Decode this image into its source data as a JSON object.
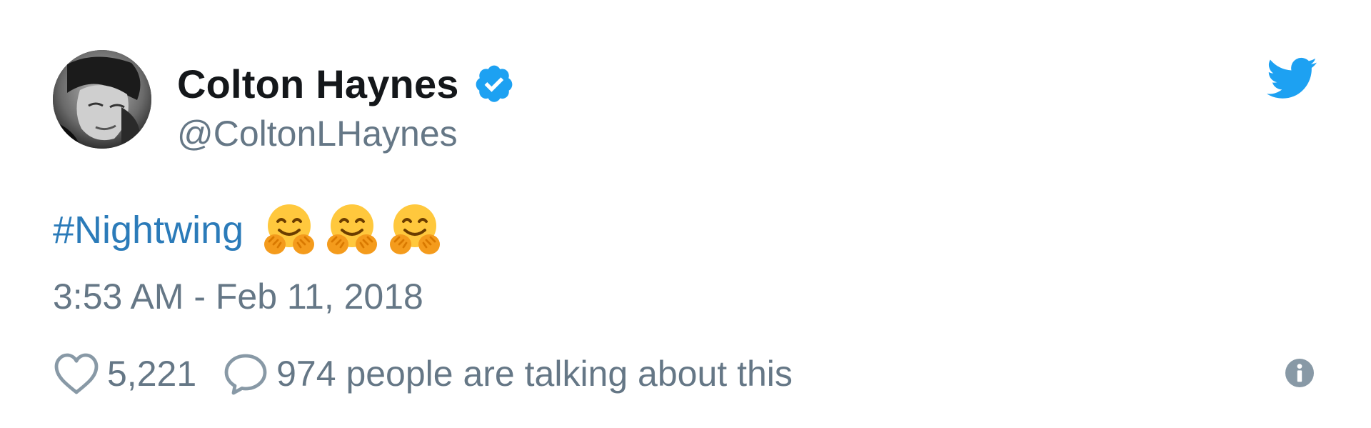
{
  "author": {
    "name": "Colton Haynes",
    "handle": "@ColtonLHaynes",
    "verified": true
  },
  "tweet": {
    "hashtag": "#Nightwing",
    "emoji": [
      "hugging-face",
      "hugging-face",
      "hugging-face"
    ],
    "timestamp": "3:53 AM - Feb 11, 2018"
  },
  "actions": {
    "likes": "5,221",
    "talking": "974 people are talking about this"
  },
  "icons": {
    "verified": "verified-badge-icon",
    "brand": "twitter-bird-icon",
    "like": "heart-icon",
    "comment": "comment-icon",
    "info": "info-icon"
  },
  "colors": {
    "name": "#14171a",
    "secondary": "#657786",
    "link": "#2b7bb9",
    "brand": "#1da1f2"
  }
}
